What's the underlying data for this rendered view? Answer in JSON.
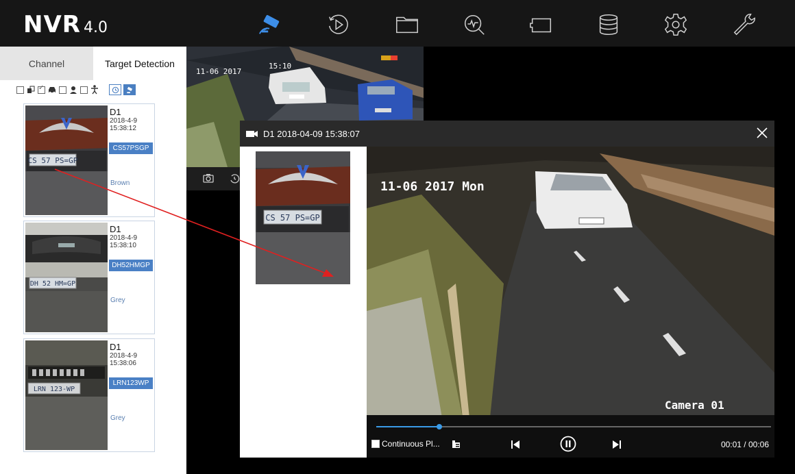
{
  "app": {
    "title_main": "NVR",
    "title_version": "4.0"
  },
  "nav": [
    {
      "icon": "live-view-camera-icon",
      "active": true
    },
    {
      "icon": "playback-icon",
      "active": false
    },
    {
      "icon": "file-management-icon",
      "active": false
    },
    {
      "icon": "smart-analysis-icon",
      "active": false
    },
    {
      "icon": "camera-config-icon",
      "active": false
    },
    {
      "icon": "storage-icon",
      "active": false
    },
    {
      "icon": "settings-icon",
      "active": false
    },
    {
      "icon": "maintenance-icon",
      "active": false
    }
  ],
  "sidebar": {
    "tabs": [
      {
        "label": "Channel",
        "active": false
      },
      {
        "label": "Target Detection",
        "active": true
      }
    ],
    "filters": {
      "vehicle_checked": true
    },
    "results": [
      {
        "channel": "D1",
        "date": "2018-4-9",
        "time": "15:38:12",
        "plate": "CS57PSGP",
        "color": "Brown",
        "plate_text": "CS 57 PS=GP"
      },
      {
        "channel": "D1",
        "date": "2018-4-9",
        "time": "15:38:10",
        "plate": "DH52HMGP",
        "color": "Grey",
        "plate_text": "DH 52 HM=GP"
      },
      {
        "channel": "D1",
        "date": "2018-4-9",
        "time": "15:38:06",
        "plate": "LRN123WP",
        "color": "Grey",
        "plate_text": "LRN 123-WP"
      }
    ]
  },
  "live": {
    "osd_date": "11-06 2017",
    "osd_time": "15:10"
  },
  "popup": {
    "title": "D1 2018-04-09 15:38:07",
    "thumb_plate": "CS 57 PS=GP",
    "video_osd_date": "11-06 2017 Mon",
    "video_osd_camera": "Camera 01",
    "continuous_label": "Continuous Pl...",
    "time": "00:01 / 00:06",
    "progress": 0.16
  },
  "colors": {
    "accent": "#4a80c5",
    "progress": "#3a9be8",
    "annotation_arrow": "#e02020"
  }
}
